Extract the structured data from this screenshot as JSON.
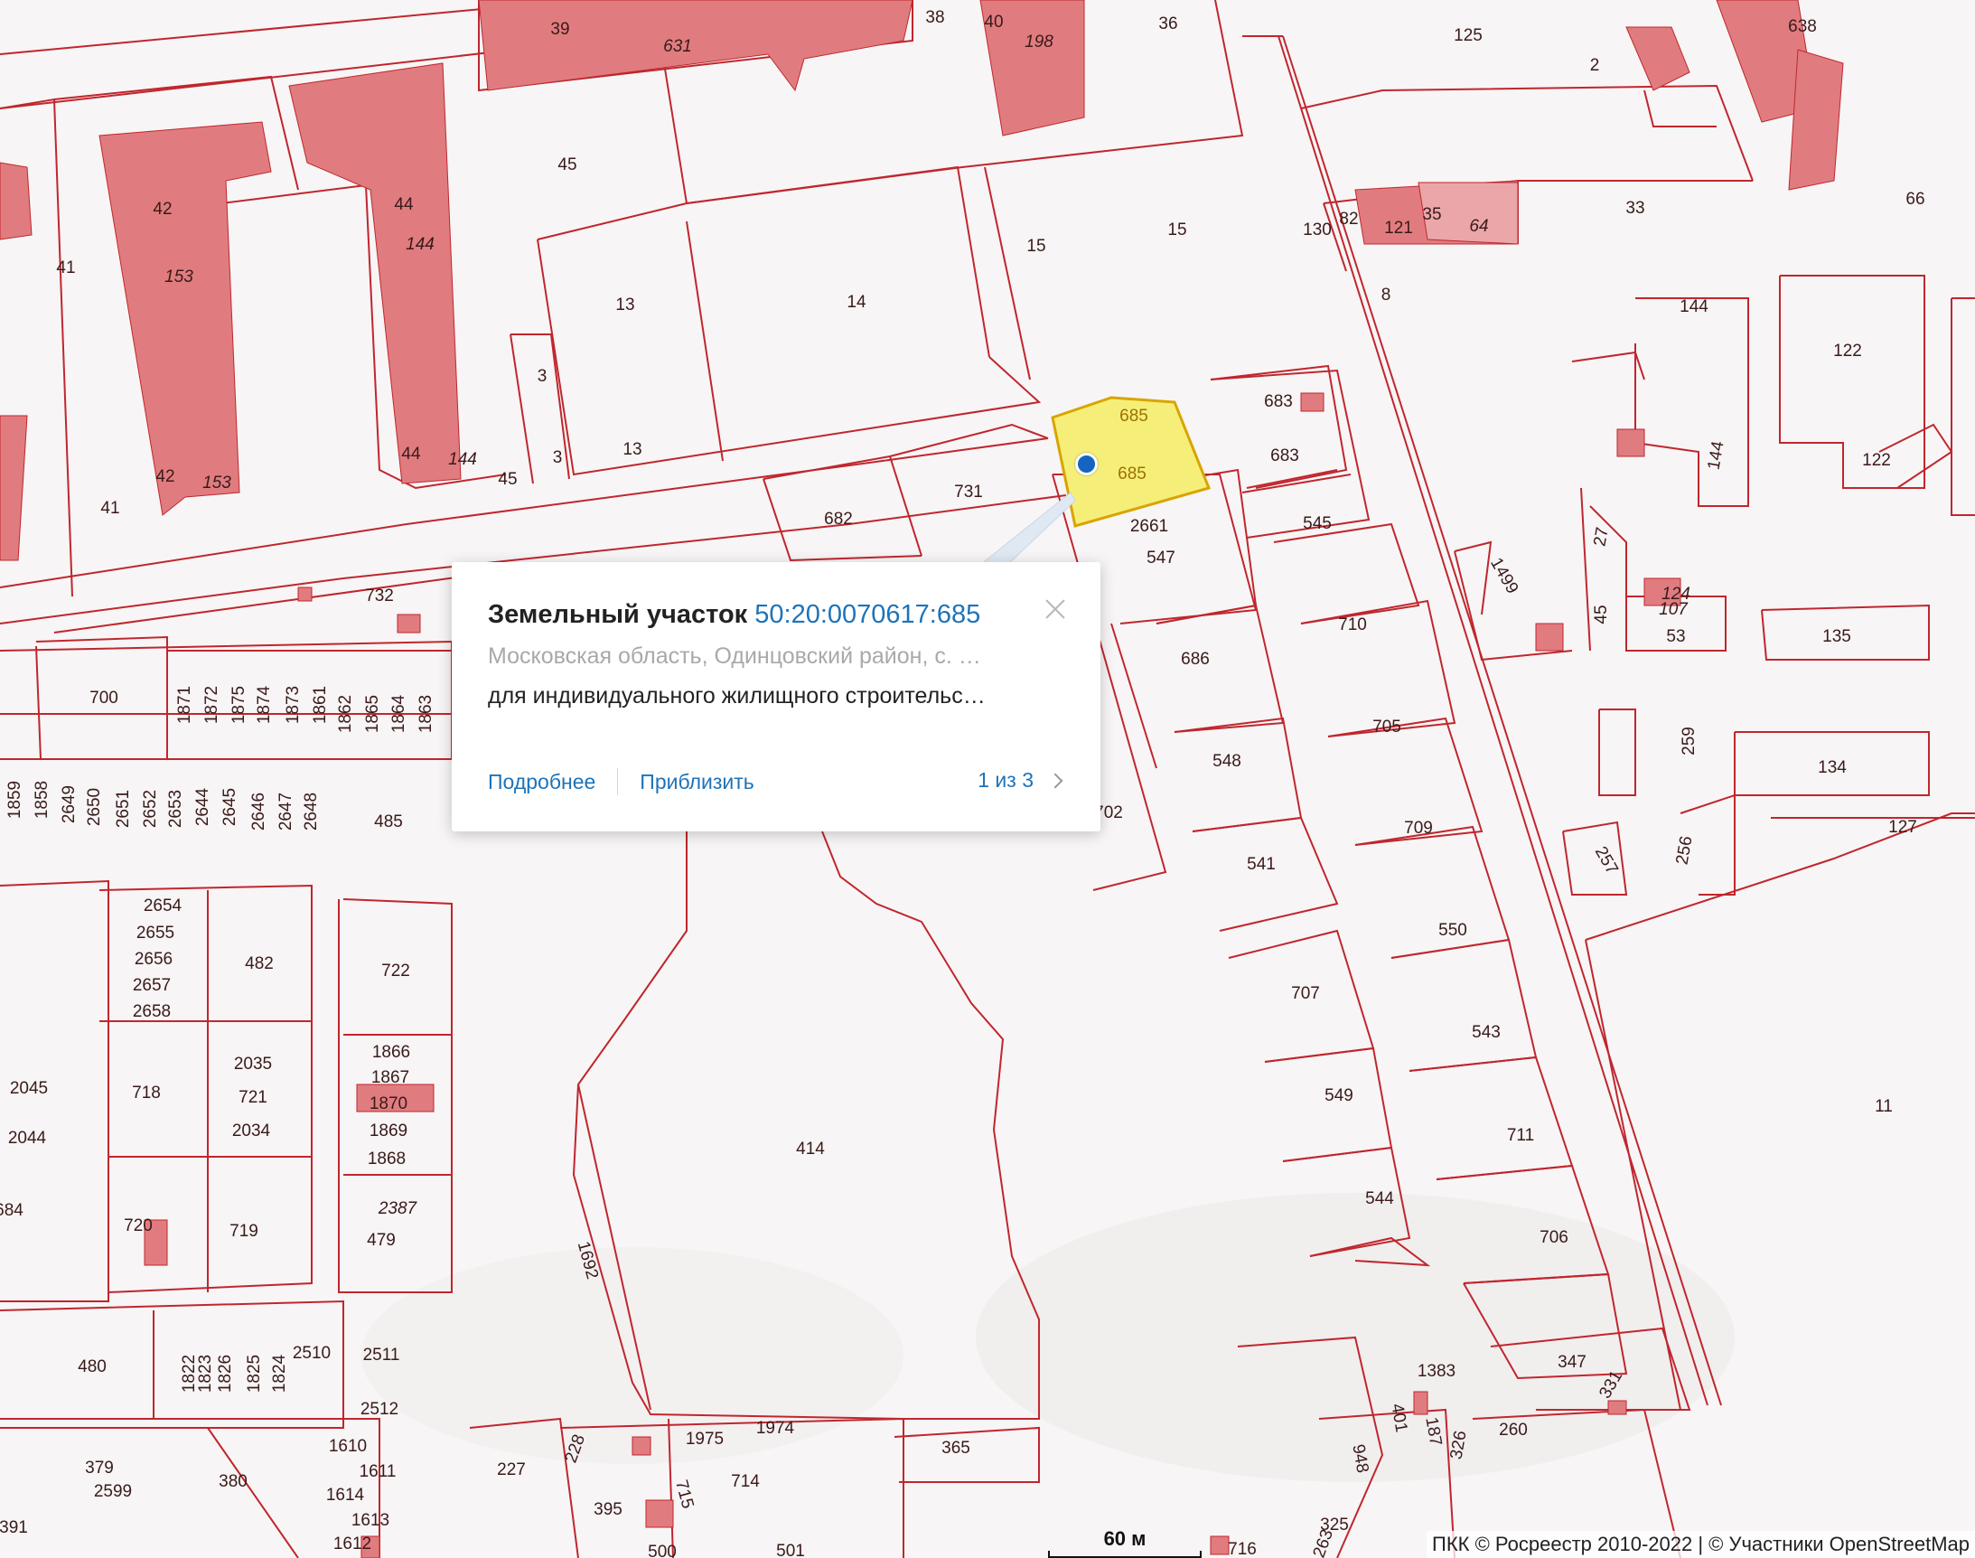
{
  "map": {
    "parcel_labels": [
      "39",
      "631",
      "38",
      "40",
      "198",
      "36",
      "125",
      "2",
      "638",
      "45",
      "42",
      "153",
      "44",
      "144",
      "41",
      "15",
      "14",
      "13",
      "3",
      "130",
      "82",
      "121",
      "35",
      "64",
      "33",
      "66",
      "8",
      "683",
      "685",
      "731",
      "682",
      "2661",
      "547",
      "545",
      "710",
      "686",
      "705",
      "548",
      "709",
      "541",
      "550",
      "707",
      "543",
      "549",
      "711",
      "544",
      "706",
      "11",
      "732",
      "700",
      "1871",
      "1872",
      "1875",
      "1874",
      "1873",
      "1861",
      "1862",
      "1865",
      "1864",
      "1863",
      "1859",
      "1858",
      "2649",
      "2650",
      "2651",
      "2652",
      "2653",
      "2644",
      "2645",
      "2646",
      "2647",
      "2648",
      "485",
      "702",
      "2654",
      "2655",
      "2656",
      "2657",
      "2658",
      "482",
      "722",
      "1866",
      "1867",
      "1870",
      "1869",
      "1868",
      "2035",
      "721",
      "2034",
      "718",
      "2045",
      "2044",
      "720",
      "719",
      "2387",
      "479",
      "684",
      "414",
      "1692",
      "480",
      "1822",
      "1823",
      "1826",
      "1825",
      "1824",
      "2510",
      "2511",
      "2512",
      "1610",
      "1611",
      "1614",
      "1613",
      "1612",
      "379",
      "2599",
      "380",
      "391",
      "227",
      "228",
      "1975",
      "1974",
      "395",
      "715",
      "714",
      "365",
      "500",
      "501",
      "716",
      "325",
      "263",
      "948",
      "401",
      "187",
      "326",
      "1383",
      "347",
      "331",
      "260",
      "144",
      "122",
      "27",
      "45",
      "124",
      "107",
      "53",
      "135",
      "1499",
      "259",
      "134",
      "127",
      "257",
      "256"
    ],
    "selected_parcel": "685"
  },
  "popup": {
    "title": "Земельный участок",
    "cadastral_number": "50:20:0070617:685",
    "address": "Московская область, Одинцовский район, с. …",
    "usage": "для индивидуального жилищного строительс…",
    "link_details": "Подробнее",
    "link_zoom": "Приблизить",
    "pager": "1 из 3"
  },
  "scale": {
    "label": "60 м"
  },
  "attribution": "ПКК © Росреестр 2010-2022 | © Участники OpenStreetMap",
  "colors": {
    "parcel_stroke": "#c0262e",
    "building_fill": "#e07c7f",
    "selected_fill": "#f5ef7a",
    "link": "#1e73b8"
  }
}
